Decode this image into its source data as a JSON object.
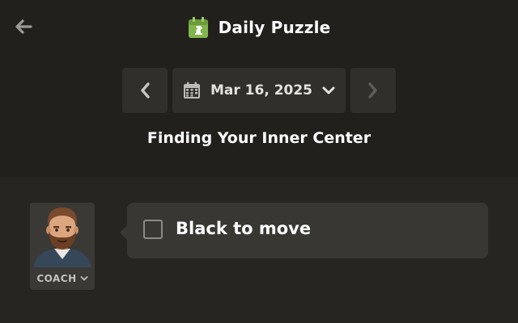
{
  "header": {
    "back_icon": "arrow-left-icon",
    "app_icon": "daily-puzzle-calendar-icon",
    "app_title": "Daily Puzzle",
    "accent_color": "#81b64c"
  },
  "date_nav": {
    "prev_icon": "chevron-left-icon",
    "calendar_icon": "calendar-icon",
    "date": "Mar 16, 2025",
    "dropdown_icon": "chevron-down-icon",
    "next_icon": "chevron-right-icon",
    "next_disabled": true
  },
  "puzzle": {
    "title": "Finding Your Inner Center"
  },
  "coach": {
    "avatar_icon": "coach-avatar",
    "label": "COACH",
    "dropdown_icon": "chevron-down-icon"
  },
  "message": {
    "checkbox_checked": false,
    "text": "Black to move"
  }
}
